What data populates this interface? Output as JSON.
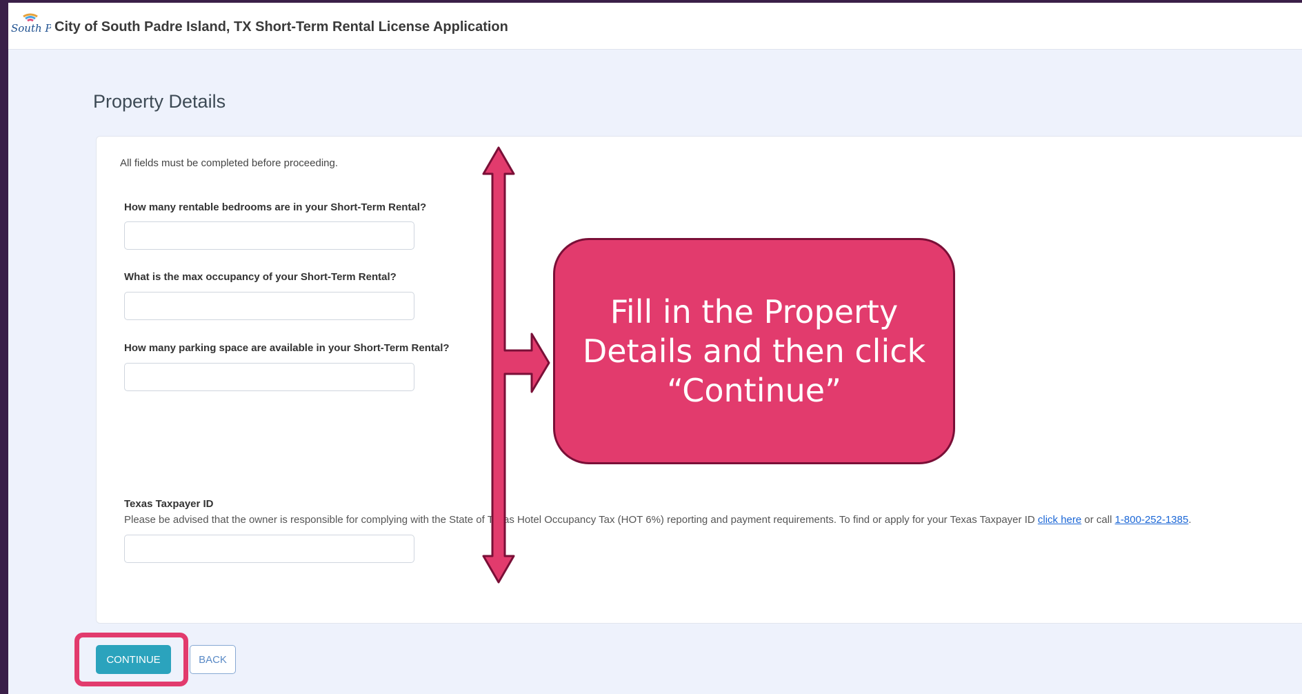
{
  "header": {
    "app_title": "City of South Padre Island, TX Short-Term Rental License Application",
    "logo_text": "South Padre Island"
  },
  "page": {
    "title": "Property Details"
  },
  "form": {
    "intro": "All fields must be completed before proceeding.",
    "questions": [
      {
        "label": "How many rentable bedrooms are in your Short-Term Rental?",
        "value": ""
      },
      {
        "label": "What is the max occupancy of your Short-Term Rental?",
        "value": ""
      },
      {
        "label": "How many parking space are available in your Short-Term Rental?",
        "value": ""
      },
      {
        "label": "Texas Taxpayer ID",
        "value": ""
      }
    ],
    "taxpayer_note": {
      "before_link": "Please be advised that the owner is responsible for complying with the State of Texas Hotel Occupancy Tax (HOT 6%) reporting and payment requirements. To find or apply for your Texas Taxpayer ID ",
      "link_text": "click here",
      "middle": " or call ",
      "phone": "1-800-252-1385",
      "after": "."
    }
  },
  "buttons": {
    "continue_label": "CONTINUE",
    "back_label": "BACK"
  },
  "annotation": {
    "callout_text": "Fill in the Property\nDetails and then click\n“Continue”",
    "accent_color": "#e23b6d",
    "accent_border_color": "#7a0f37"
  }
}
